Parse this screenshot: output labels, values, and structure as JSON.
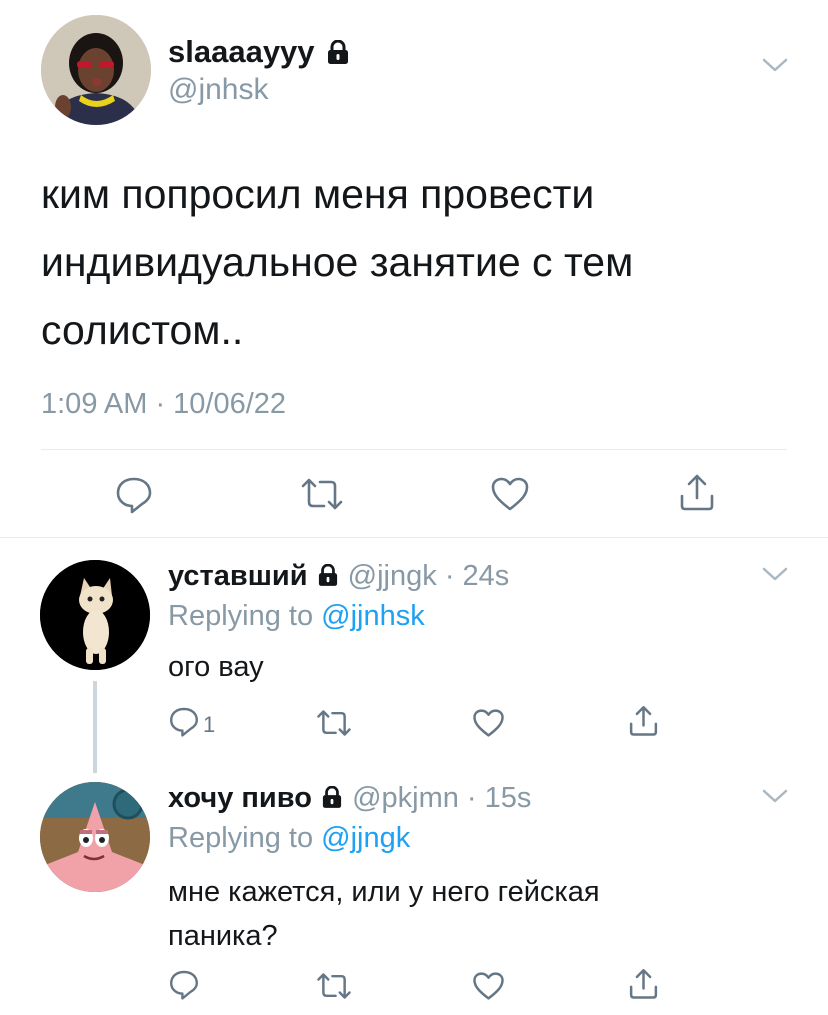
{
  "main_tweet": {
    "display_name": "slaaaayyy",
    "handle": "@jnhsk",
    "text_lines": [
      "ким попросил меня провести",
      "индивидуальное занятие с тем",
      "солистом.."
    ],
    "timestamp": "1:09 AM · 10/06/22",
    "avatar_icon": "person-with-sunglasses-avatar"
  },
  "replies": [
    {
      "display_name": "уставший",
      "handle": "@jjngk",
      "sep": "·",
      "time": "24s",
      "replying_prefix": "Replying to",
      "replying_to": "@jjnhsk",
      "text": "ого вау",
      "reply_count": "1",
      "avatar_icon": "standing-cat-avatar"
    },
    {
      "display_name": "хочу пиво",
      "handle": "@pkjmn",
      "sep": "·",
      "time": "15s",
      "replying_prefix": "Replying to",
      "replying_to": "@jjngk",
      "text_lines": [
        "мне кажется, или у него гейская",
        "паника?"
      ],
      "avatar_icon": "patrick-star-avatar"
    }
  ],
  "colors": {
    "text": "#14171a",
    "secondary": "#8899a6",
    "link": "#1da1f2",
    "divider": "#e6ecf0",
    "icon": "#657786"
  }
}
